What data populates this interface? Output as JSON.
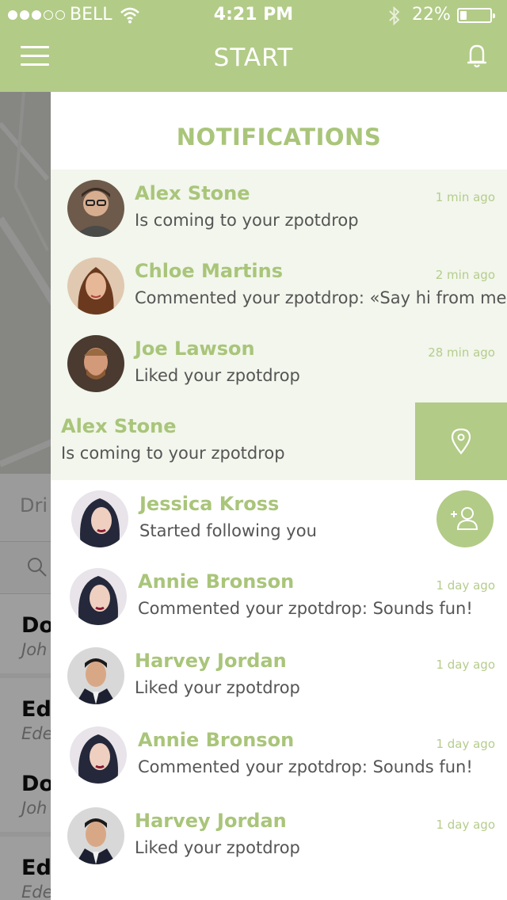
{
  "status_bar": {
    "carrier": "BELL",
    "time": "4:21 PM",
    "battery_text": "22%",
    "battery_level": 0.22,
    "signal_bars": 3,
    "signal_total": 5
  },
  "header": {
    "title": "START",
    "menu_icon": "hamburger-icon",
    "bell_icon": "bell-icon"
  },
  "background_app": {
    "filter_text": "Dri",
    "items": [
      {
        "title": "Do",
        "subtitle": "Joh"
      },
      {
        "title": "Ed",
        "subtitle": "Ede"
      },
      {
        "title": "Do",
        "subtitle": "Joh"
      },
      {
        "title": "Ed",
        "subtitle": "Ede"
      }
    ]
  },
  "notifications": {
    "title": "NOTIFICATIONS",
    "items": [
      {
        "name": "Alex Stone",
        "message": "Is coming to your zpotdrop",
        "time": "1 min ago",
        "unread": true
      },
      {
        "name": "Chloe Martins",
        "message": "Commented your zpotdrop: «Say hi from me!»",
        "time": "2 min ago",
        "unread": true
      },
      {
        "name": "Joe Lawson",
        "message": "Liked your zpotdrop",
        "time": "28 min ago",
        "unread": true
      }
    ],
    "swiped_item": {
      "name": "Alex Stone",
      "message": "Is coming to your zpotdrop",
      "action_icon": "map-pin-icon"
    },
    "read_items": [
      {
        "name": "Jessica Kross",
        "message": "Started following you",
        "time": "",
        "action_icon": "add-user-icon"
      },
      {
        "name": "Annie Bronson",
        "message": "Commented your zpotdrop: Sounds fun!",
        "time": "1 day ago"
      },
      {
        "name": "Harvey Jordan",
        "message": "Liked your zpotdrop",
        "time": "1 day ago"
      },
      {
        "name": "Annie Bronson",
        "message": "Commented your zpotdrop: Sounds fun!",
        "time": "1 day ago"
      },
      {
        "name": "Harvey Jordan",
        "message": "Liked your zpotdrop",
        "time": "1 day ago"
      }
    ]
  },
  "colors": {
    "accent": "#b2cb87",
    "accent_text": "#a9c57a",
    "unread_bg": "#f2f6ec"
  }
}
